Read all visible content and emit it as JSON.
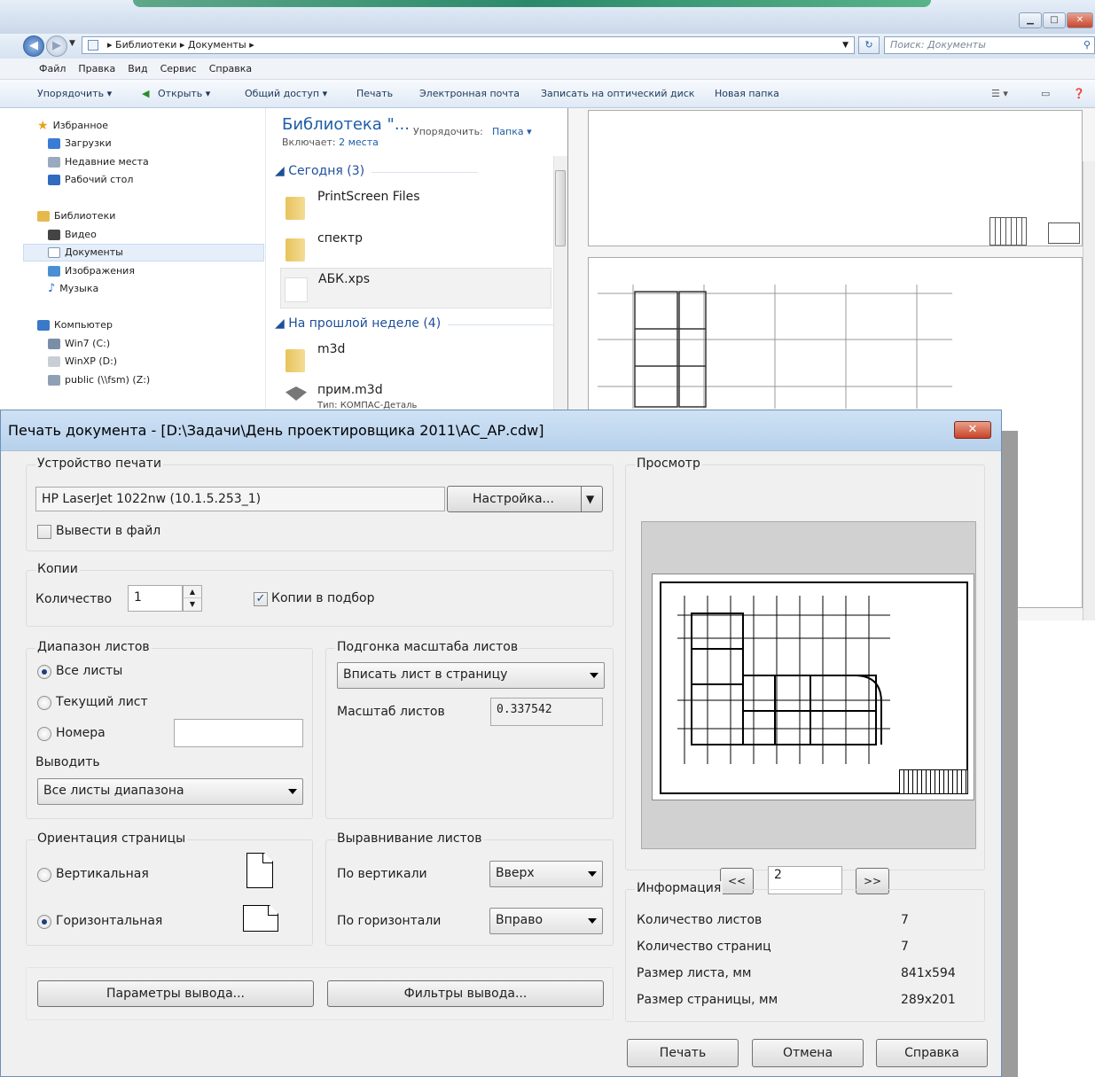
{
  "explorer": {
    "breadcrumb": "▸ Библиотеки ▸ Документы ▸",
    "search_placeholder": "Поиск: Документы",
    "menu": [
      "Файл",
      "Правка",
      "Вид",
      "Сервис",
      "Справка"
    ],
    "toolbar": {
      "organize": "Упорядочить ▾",
      "open": "Открыть ▾",
      "share": "Общий доступ ▾",
      "print": "Печать",
      "email": "Электронная почта",
      "burn": "Записать на оптический диск",
      "new_folder": "Новая папка"
    },
    "nav": {
      "favorites": "Избранное",
      "downloads": "Загрузки",
      "recent": "Недавние места",
      "desktop": "Рабочий стол",
      "libraries": "Библиотеки",
      "video": "Видео",
      "documents": "Документы",
      "images": "Изображения",
      "music": "Музыка",
      "computer": "Компьютер",
      "win7": "Win7 (C:)",
      "winxp": "WinXP (D:)",
      "public": "public (\\\\fsm) (Z:)"
    },
    "library": {
      "title": "Библиотека \"...",
      "includes_label": "Включает:",
      "includes_value": "2 места",
      "sort_label": "Упорядочить:",
      "sort_value": "Папка ▾"
    },
    "groups": {
      "today": "◢ Сегодня (3)",
      "last_week": "◢ На прошлой неделе (4)"
    },
    "files": {
      "f1": "PrintScreen Files",
      "f2": "спектр",
      "f3": "АБК.xps",
      "f4": "m3d",
      "f5": "прим.m3d",
      "f5_sub": "Тип: КОМПАС-Деталь"
    }
  },
  "dialog": {
    "title": "Печать документа - [D:\\Задачи\\День проектировщика 2011\\АС_АР.cdw]",
    "close_label": "✕",
    "printer": {
      "group": "Устройство печати",
      "name": "HP LaserJet 1022nw (10.1.5.253_1)",
      "setup_button": "Настройка...",
      "to_file": "Вывести в файл"
    },
    "copies": {
      "group": "Копии",
      "quantity_label": "Количество",
      "quantity_value": "1",
      "collate": "Копии в подбор"
    },
    "range": {
      "group": "Диапазон листов",
      "all": "Все листы",
      "current": "Текущий лист",
      "numbers": "Номера",
      "output_label": "Выводить",
      "output_value": "Все листы диапазона"
    },
    "scale": {
      "group": "Подгонка масштаба листов",
      "fit_value": "Вписать лист в страницу",
      "scale_label": "Масштаб листов",
      "scale_value": "0.337542"
    },
    "orientation": {
      "group": "Ориентация страницы",
      "portrait": "Вертикальная",
      "landscape": "Горизонтальная"
    },
    "alignment": {
      "group": "Выравнивание листов",
      "vertical_label": "По вертикали",
      "vertical_value": "Вверх",
      "horizontal_label": "По горизонтали",
      "horizontal_value": "Вправо"
    },
    "buttons": {
      "output_params": "Параметры вывода...",
      "output_filters": "Фильтры вывода...",
      "print": "Печать",
      "cancel": "Отмена",
      "help": "Справка"
    },
    "preview": {
      "group": "Просмотр",
      "prev": "<<",
      "page": "2",
      "next": ">>"
    },
    "info": {
      "group": "Информация",
      "sheets_label": "Количество листов",
      "sheets_value": "7",
      "pages_label": "Количество страниц",
      "pages_value": "7",
      "sheet_size_label": "Размер листа, мм",
      "sheet_size_value": "841x594",
      "page_size_label": "Размер страницы, мм",
      "page_size_value": "289x201"
    }
  }
}
